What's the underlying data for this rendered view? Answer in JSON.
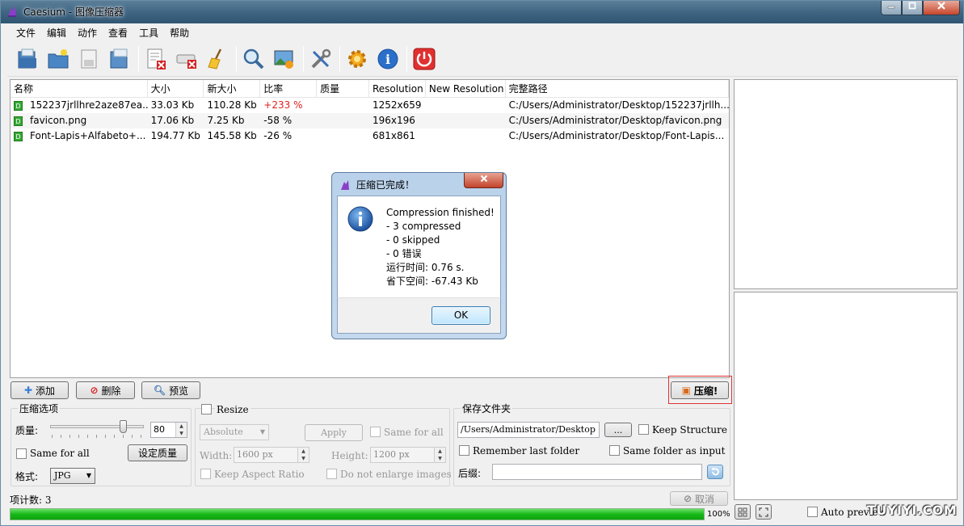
{
  "window": {
    "title": "Caesium - 图像压缩器"
  },
  "menu": [
    "文件",
    "编辑",
    "动作",
    "查看",
    "工具",
    "帮助"
  ],
  "toolbar_icons": [
    "open-file-icon",
    "open-folder-icon",
    "save-icon",
    "save-as-icon",
    "clear-list-icon",
    "remove-drive-icon",
    "clean-icon",
    "search-icon",
    "preview-image-icon",
    "tools-icon",
    "settings-icon",
    "info-icon",
    "power-icon"
  ],
  "filelist": {
    "headers": [
      "名称",
      "大小",
      "新大小",
      "比率",
      "质量",
      "Resolution",
      "New Resolution",
      "完整路径"
    ],
    "rows": [
      {
        "name": "152237jrllhre2aze87ea...",
        "size": "33.03 Kb",
        "new_size": "110.28 Kb",
        "ratio": "+233 %",
        "quality": "",
        "resolution": "1252x659",
        "new_resolution": "",
        "path": "C:/Users/Administrator/Desktop/152237jrllh..."
      },
      {
        "name": "favicon.png",
        "size": "17.06 Kb",
        "new_size": "7.25 Kb",
        "ratio": "-58 %",
        "quality": "",
        "resolution": "196x196",
        "new_resolution": "",
        "path": "C:/Users/Administrator/Desktop/favicon.png"
      },
      {
        "name": "Font-Lapis+Alfabeto+...",
        "size": "194.77 Kb",
        "new_size": "145.58 Kb",
        "ratio": "-26 %",
        "quality": "",
        "resolution": "681x861",
        "new_resolution": "",
        "path": "C:/Users/Administrator/Desktop/Font-Lapis..."
      }
    ]
  },
  "actions": {
    "add": "添加",
    "delete": "删除",
    "preview": "预览",
    "compress": "压缩!"
  },
  "compress_options": {
    "title": "压缩选项",
    "quality_label": "质量:",
    "quality_value": "80",
    "quality_fraction": 0.8,
    "same_for_all": "Same for all",
    "set_quality": "设定质量",
    "format_label": "格式:",
    "format_value": "JPG"
  },
  "resize": {
    "title": "Resize",
    "mode": "Absolute",
    "apply": "Apply",
    "same_for_all": "Same for all",
    "width_label": "Width:",
    "width_value": "1600 px",
    "height_label": "Height:",
    "height_value": "1200 px",
    "keep_aspect": "Keep Aspect Ratio",
    "no_enlarge": "Do not enlarge images"
  },
  "output": {
    "title": "保存文件夹",
    "path": "/Users/Administrator/Desktop",
    "browse": "...",
    "keep_structure": "Keep Structure",
    "remember_last": "Remember last folder",
    "same_as_input": "Same folder as input",
    "suffix_label": "后缀:",
    "suffix_value": ""
  },
  "status": {
    "item_count": "项计数: 3",
    "cancel": "取消",
    "progress_pct": "100%",
    "progress_value": 1.0
  },
  "preview_panel": {
    "auto_preview": "Auto preview"
  },
  "dialog": {
    "title": "压缩已完成！",
    "lines": [
      "Compression finished!",
      "- 3 compressed",
      "- 0 skipped",
      "- 0 错误",
      "运行时间: 0.76 s.",
      "省下空间: -67.43 Kb"
    ],
    "ok": "OK"
  },
  "watermark": "TUYIYI.COM"
}
